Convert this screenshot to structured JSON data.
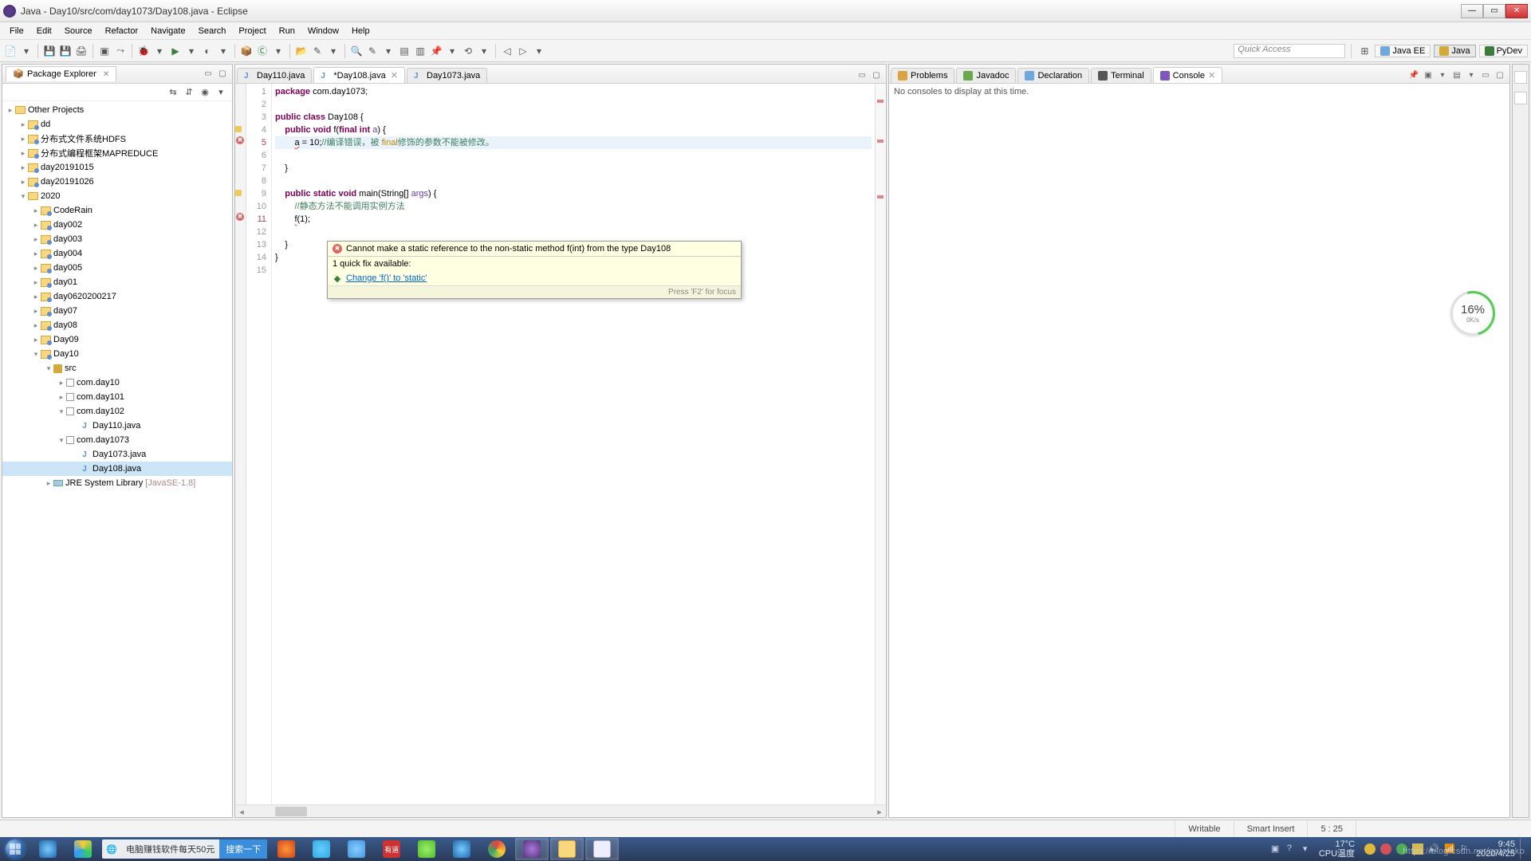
{
  "window": {
    "title": "Java - Day10/src/com/day1073/Day108.java - Eclipse"
  },
  "menus": [
    "File",
    "Edit",
    "Source",
    "Refactor",
    "Navigate",
    "Search",
    "Project",
    "Run",
    "Window",
    "Help"
  ],
  "quick_access": "Quick Access",
  "perspectives": {
    "java_ee": "Java EE",
    "java": "Java",
    "pydev": "PyDev"
  },
  "package_explorer": {
    "title": "Package Explorer",
    "items": [
      {
        "d": 0,
        "t": "Other Projects",
        "k": "folder",
        "tw": "▸"
      },
      {
        "d": 1,
        "t": "dd",
        "k": "proj",
        "tw": "▸"
      },
      {
        "d": 1,
        "t": "分布式文件系统HDFS",
        "k": "proj",
        "tw": "▸"
      },
      {
        "d": 1,
        "t": "分布式编程框架MAPREDUCE",
        "k": "proj",
        "tw": "▸"
      },
      {
        "d": 1,
        "t": "day20191015",
        "k": "proj",
        "tw": "▸"
      },
      {
        "d": 1,
        "t": "day20191026",
        "k": "proj",
        "tw": "▸"
      },
      {
        "d": 1,
        "t": "2020",
        "k": "folder",
        "tw": "▾"
      },
      {
        "d": 2,
        "t": "CodeRain",
        "k": "proj",
        "tw": "▸"
      },
      {
        "d": 2,
        "t": "day002",
        "k": "proj",
        "tw": "▸"
      },
      {
        "d": 2,
        "t": "day003",
        "k": "proj",
        "tw": "▸"
      },
      {
        "d": 2,
        "t": "day004",
        "k": "proj",
        "tw": "▸"
      },
      {
        "d": 2,
        "t": "day005",
        "k": "proj",
        "tw": "▸"
      },
      {
        "d": 2,
        "t": "day01",
        "k": "proj",
        "tw": "▸"
      },
      {
        "d": 2,
        "t": "day0620200217",
        "k": "proj",
        "tw": "▸"
      },
      {
        "d": 2,
        "t": "day07",
        "k": "proj",
        "tw": "▸"
      },
      {
        "d": 2,
        "t": "day08",
        "k": "proj",
        "tw": "▸"
      },
      {
        "d": 2,
        "t": "Day09",
        "k": "proj",
        "tw": "▸"
      },
      {
        "d": 2,
        "t": "Day10",
        "k": "proj",
        "tw": "▾"
      },
      {
        "d": 3,
        "t": "src",
        "k": "pkg",
        "tw": "▾"
      },
      {
        "d": 4,
        "t": "com.day10",
        "k": "pkg2",
        "tw": "▸"
      },
      {
        "d": 4,
        "t": "com.day101",
        "k": "pkg2",
        "tw": "▸"
      },
      {
        "d": 4,
        "t": "com.day102",
        "k": "pkg2",
        "tw": "▾"
      },
      {
        "d": 5,
        "t": "Day110.java",
        "k": "jfile",
        "tw": ""
      },
      {
        "d": 4,
        "t": "com.day1073",
        "k": "pkg2",
        "tw": "▾"
      },
      {
        "d": 5,
        "t": "Day1073.java",
        "k": "jfile",
        "tw": ""
      },
      {
        "d": 5,
        "t": "Day108.java",
        "k": "jfile",
        "tw": "",
        "sel": true
      },
      {
        "d": 3,
        "t": "JRE System Library",
        "k": "lib",
        "tw": "▸",
        "extra": " [JavaSE-1.8]"
      }
    ]
  },
  "editor_tabs": [
    {
      "label": "Day110.java",
      "active": false,
      "dirty": false
    },
    {
      "label": "*Day108.java",
      "active": true,
      "dirty": true
    },
    {
      "label": "Day1073.java",
      "active": false,
      "dirty": false
    }
  ],
  "code_lines": [
    {
      "n": 1,
      "html": "<span class='kw'>package</span> com.day1073;"
    },
    {
      "n": 2,
      "html": ""
    },
    {
      "n": 3,
      "html": "<span class='kw'>public</span> <span class='kw'>class</span> Day108 {"
    },
    {
      "n": 4,
      "html": "    <span class='kw'>public</span> <span class='kw'>void</span> f(<span class='kw'>final</span> <span class='kw'>int</span> <span class='var'>a</span>) {",
      "warn": true
    },
    {
      "n": 5,
      "html": "        <span class='fn'>a</span> = 10;<span class='cm'>//编译错误，被</span> <span class='cm2'>final</span><span class='cm'>修饰的参数不能被修改。</span>",
      "err": true,
      "hl": true
    },
    {
      "n": 6,
      "html": ""
    },
    {
      "n": 7,
      "html": "    }"
    },
    {
      "n": 8,
      "html": ""
    },
    {
      "n": 9,
      "html": "    <span class='kw'>public</span> <span class='kw'>static</span> <span class='kw'>void</span> main(String[] <span class='var'>args</span>) {",
      "warn": true
    },
    {
      "n": 10,
      "html": "        <span class='cm'>//静态方法不能调用实例方法</span>"
    },
    {
      "n": 11,
      "html": "        <span class='fn'>f</span>(1);",
      "err": true
    },
    {
      "n": 12,
      "html": ""
    },
    {
      "n": 13,
      "html": "    }"
    },
    {
      "n": 14,
      "html": "}"
    },
    {
      "n": 15,
      "html": ""
    }
  ],
  "tooltip": {
    "error": "Cannot make a static reference to the non-static method f(int) from the type Day108",
    "fix_header": "1 quick fix available:",
    "fix_link": "Change 'f()' to 'static'",
    "footer": "Press 'F2' for focus"
  },
  "right_tabs": [
    {
      "label": "Problems",
      "icn": "#d9a441"
    },
    {
      "label": "Javadoc",
      "icn": "#6aa84f"
    },
    {
      "label": "Declaration",
      "icn": "#6fa8dc"
    },
    {
      "label": "Terminal",
      "icn": "#555"
    },
    {
      "label": "Console",
      "icn": "#7e57c2",
      "active": true
    }
  ],
  "console_msg": "No consoles to display at this time.",
  "speed": {
    "big": "16%",
    "small": "0K/s"
  },
  "status": {
    "writable": "Writable",
    "insert": "Smart Insert",
    "pos": "5 : 25"
  },
  "taskbar": {
    "search_text": "电脑赚钱软件每天50元",
    "search_btn": "搜索一下",
    "temp": "17°C",
    "cpu": "CPU温度",
    "time": "9:45",
    "date": "2020/4/25"
  },
  "watermark": "https://blog.csdn.net/gotofako"
}
